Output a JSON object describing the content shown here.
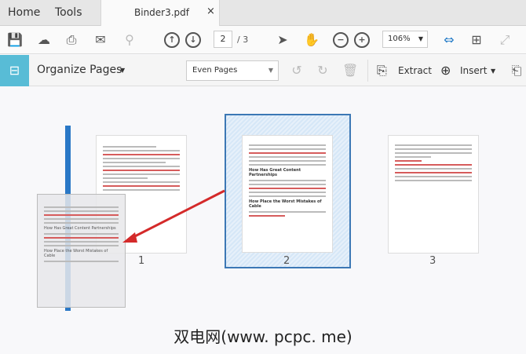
{
  "tabs": {
    "home": "Home",
    "tools": "Tools",
    "file": "Binder3.pdf",
    "close": "×"
  },
  "toolbar": {
    "page_current": "2",
    "page_total": "/ 3",
    "zoom": "106%"
  },
  "organize": {
    "title": "Organize Pages",
    "filter": "Even Pages",
    "extract": "Extract",
    "insert": "Insert"
  },
  "pages": [
    {
      "label": "1"
    },
    {
      "label": "2"
    },
    {
      "label": "3"
    }
  ],
  "page_heading_1": "How Has Great Content Partnerships",
  "page_heading_2": "How Place the Worst Mistakes of Cable",
  "watermark": "双电网(www. pcpc. me)"
}
